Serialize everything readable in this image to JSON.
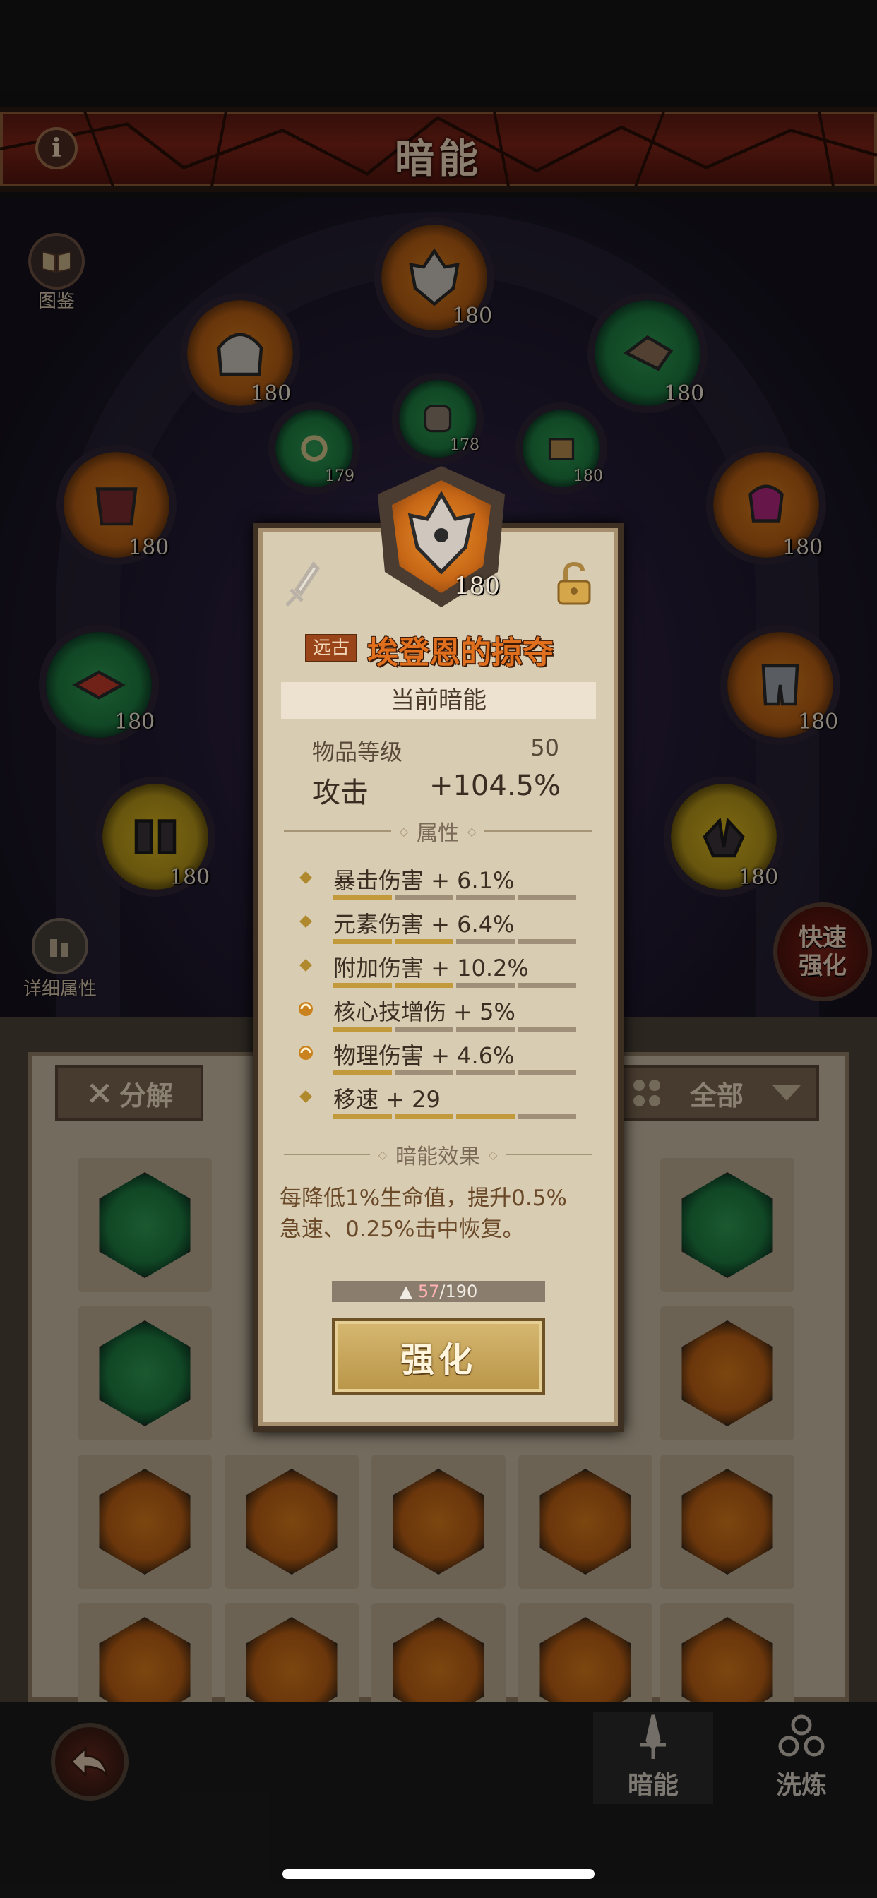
{
  "header": {
    "title": "暗能"
  },
  "side": {
    "codex_label": "图鉴",
    "detail_label": "详细属性",
    "quick_label_1": "快速",
    "quick_label_2": "强化"
  },
  "slots": {
    "top_center": "180",
    "upper_left": "180",
    "upper_right": "180",
    "inner_left": "179",
    "inner_center": "178",
    "inner_right": "180",
    "mid_left": "180",
    "mid_right": "180",
    "low_left": "180",
    "low_right": "180",
    "bottom_left": "180",
    "bottom_right": "180"
  },
  "inventory": {
    "decompose_label": "分解",
    "filter_label": "全部"
  },
  "bottom_nav": {
    "tab1": "暗能",
    "tab2": "洗炼"
  },
  "modal": {
    "item_level": "180",
    "rarity": "远古",
    "name": "埃登恩的掠夺",
    "section_current": "当前暗能",
    "item_level_label": "物品等级",
    "item_level_value": "50",
    "attack_label": "攻击",
    "attack_value": "+104.5%",
    "attributes_title": "属性",
    "attributes": [
      {
        "text": "暴击伤害 + 6.1%",
        "fill": 0.25
      },
      {
        "text": "元素伤害 + 6.4%",
        "fill": 0.5
      },
      {
        "text": "附加伤害 + 10.2%",
        "fill": 0.5
      },
      {
        "text": "核心技增伤 + 5%",
        "fill": 0.25
      },
      {
        "text": "物理伤害 + 4.6%",
        "fill": 0.25
      },
      {
        "text": "移速 + 29",
        "fill": 0.75
      }
    ],
    "effect_title": "暗能效果",
    "effect_line1": "每降低1%生命值，提升0.5%",
    "effect_line2": "急速、0.25%击中恢复。",
    "cost_current": "57",
    "cost_total": "/190",
    "enhance_label": "强化"
  }
}
